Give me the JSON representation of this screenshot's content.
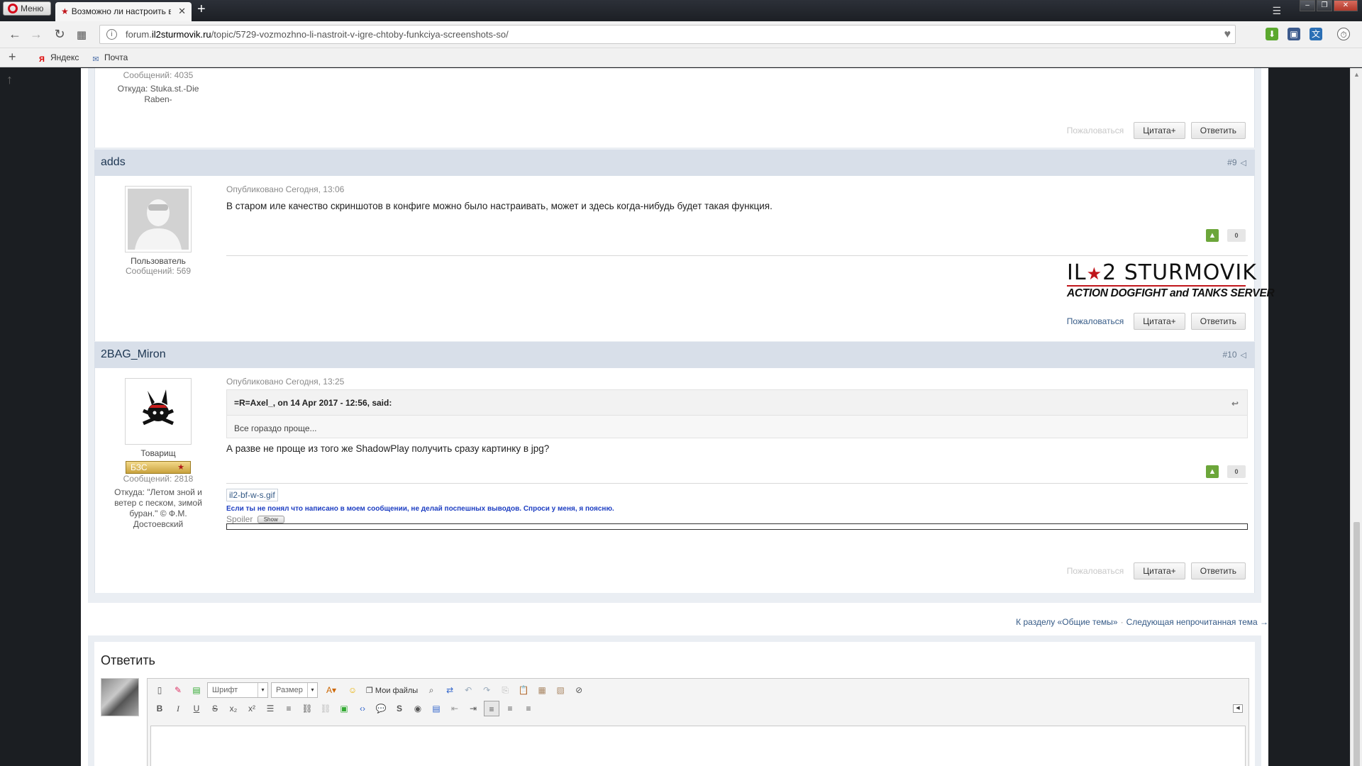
{
  "browser": {
    "menu_label": "Меню",
    "tab_title": "Возможно ли настроить в игре чтобы функция скриншотов",
    "url_prefix": "forum.",
    "url_domain": "il2sturmovik.ru",
    "url_path": "/topic/5729-vozmozhno-li-nastroit-v-igre-chtoby-funkciya-screenshots-so/",
    "bookmarks": [
      {
        "label": "Яндекс",
        "icon": "yandex-icon"
      },
      {
        "label": "Почта",
        "icon": "mail-icon"
      }
    ]
  },
  "prev_post": {
    "count": "Сообщений: 4035",
    "from": "Откуда: Stuka.st.-Die Raben-",
    "report": "Пожаловаться",
    "quote_btn": "Цитата+",
    "reply_btn": "Ответить"
  },
  "post9": {
    "author": "adds",
    "num": "#9",
    "published": "Опубликовано Сегодня, 13:06",
    "text": "В старом иле качество скриншотов в конфиге можно было настраивать, может и здесь когда-нибудь будет такая функция.",
    "rank": "Пользователь",
    "count": "Сообщений: 569",
    "votes": "0",
    "report": "Пожаловаться",
    "quote_btn": "Цитата+",
    "reply_btn": "Ответить",
    "sig_line1_a": "IL",
    "sig_line1_star": "★",
    "sig_line1_b": "2 STURMOVIK",
    "sig_line2": "ACTION DOGFIGHT and TANKS SERVER"
  },
  "post10": {
    "author": "2BAG_Miron",
    "num": "#10",
    "published": "Опубликовано Сегодня, 13:25",
    "quote_head": "=R=Axel_, on 14 Apr 2017 - 12:56, said:",
    "quote_text": "Все гораздо проще...",
    "text": "А разве не проще из того же ShadowPlay получить сразу картинку в jpg?",
    "rank": "Товарищ",
    "badge": "БЗС",
    "count": "Сообщений: 2818",
    "from": "Откуда: \"Летом зной и ветер с песком, зимой буран.\" © Ф.М. Достоевский",
    "votes": "0",
    "sig_image": "il2-bf-w-s.gif",
    "sig_text": "Если ты не понял что написано в моем сообщении, не делай поспешных выводов. Спроси у меня, я поясню.",
    "spoiler_label": "Spoiler",
    "spoiler_btn": "Show",
    "report": "Пожаловаться",
    "quote_btn": "Цитата+",
    "reply_btn": "Ответить"
  },
  "nav": {
    "back_to_section": "К разделу «Общие темы»",
    "dot": "·",
    "next_unread": "Следующая непрочитанная тема →"
  },
  "reply_form": {
    "title": "Ответить",
    "font_placeholder": "Шрифт",
    "size_placeholder": "Размер",
    "my_files": "Мои файлы"
  },
  "colors": {
    "header_bg": "#d8dfe9",
    "author": "#1d3652",
    "vote_up": "#6ca63a",
    "link": "#355a86",
    "sig_blue": "#1d3ec2",
    "accent_red": "#c0151b"
  }
}
